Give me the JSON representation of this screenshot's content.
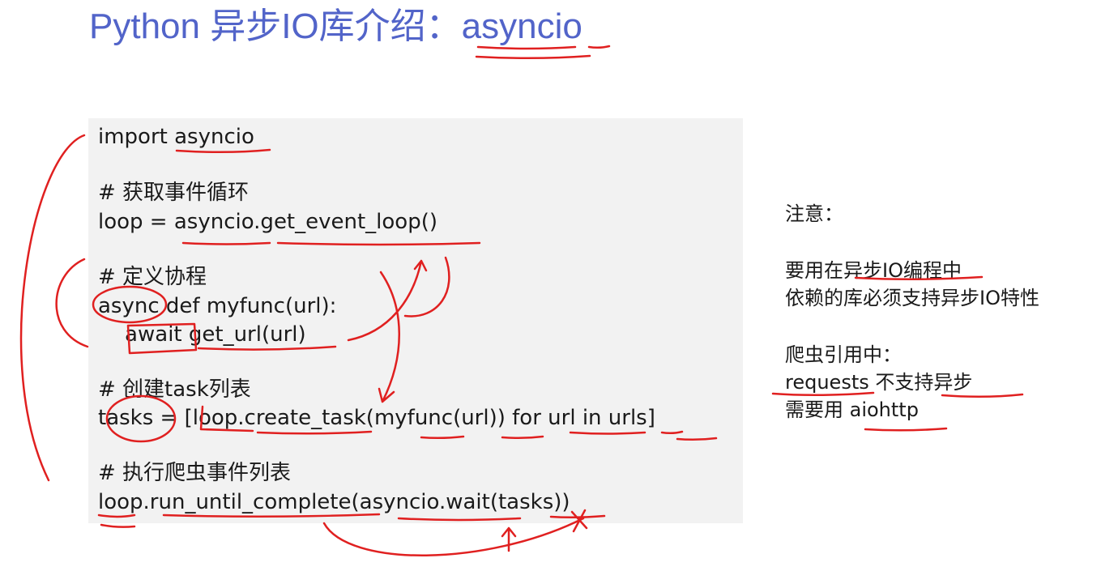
{
  "slide": {
    "title": "Python 异步IO库介绍：asyncio"
  },
  "code": {
    "lines": [
      "import asyncio",
      "# 获取事件循环",
      "loop = asyncio.get_event_loop()",
      "# 定义协程",
      "async def myfunc(url):",
      "    await get_url(url)",
      "# 创建task列表",
      "tasks = [loop.create_task(myfunc(url)) for url in urls]",
      "# 执行爬虫事件列表",
      "loop.run_until_complete(asyncio.wait(tasks))"
    ]
  },
  "notes": {
    "heading": "注意：",
    "line1": "要用在异步IO编程中",
    "line2": "依赖的库必须支持异步IO特性",
    "subheading": "爬虫引用中：",
    "line3": "requests 不支持异步",
    "line4": "需要用 aiohttp"
  },
  "colors": {
    "title": "#5264c9",
    "code_background": "#f2f2f2",
    "annotation": "#e02020"
  }
}
